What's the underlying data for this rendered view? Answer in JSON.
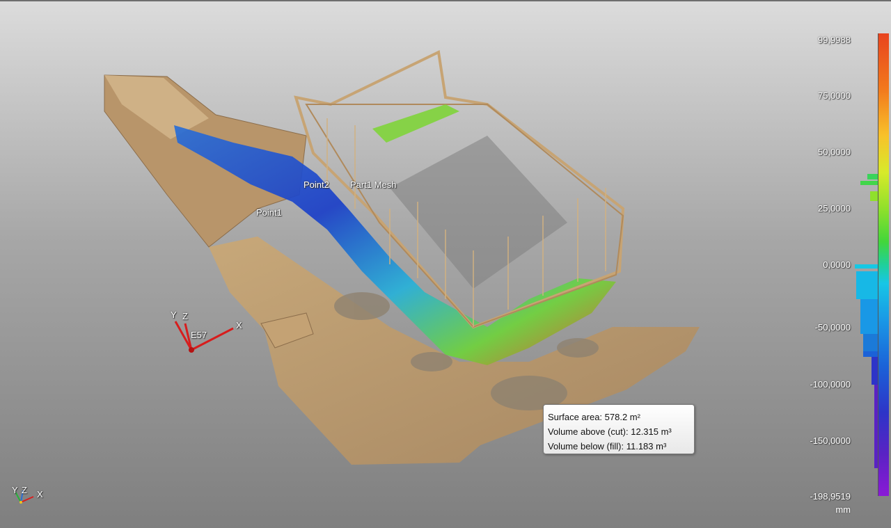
{
  "viewport": {
    "labels": {
      "point1": "Point1",
      "point2": "Point2",
      "mesh": "Part1 Mesh",
      "scan_station": "E57"
    },
    "axes": {
      "x": "X",
      "y": "Y",
      "z": "Z"
    },
    "mini_axes": {
      "x": "X",
      "y": "Y",
      "z": "Z"
    }
  },
  "measurement": {
    "surface_area": "Surface area: 578.2 m²",
    "volume_above": "Volume above (cut): 12.315 m³",
    "volume_below": "Volume below (fill): 11.183 m³"
  },
  "color_scale": {
    "ticks": [
      "99,9988",
      "75,0000",
      "50,0000",
      "25,0000",
      "0,0000",
      "-50,0000",
      "-100,0000",
      "-150,0000",
      "-198,9519"
    ],
    "unit": "mm",
    "colors": {
      "top": "#e8441f",
      "mid": "#1fd09a",
      "bottom": "#8a1ad6"
    }
  }
}
